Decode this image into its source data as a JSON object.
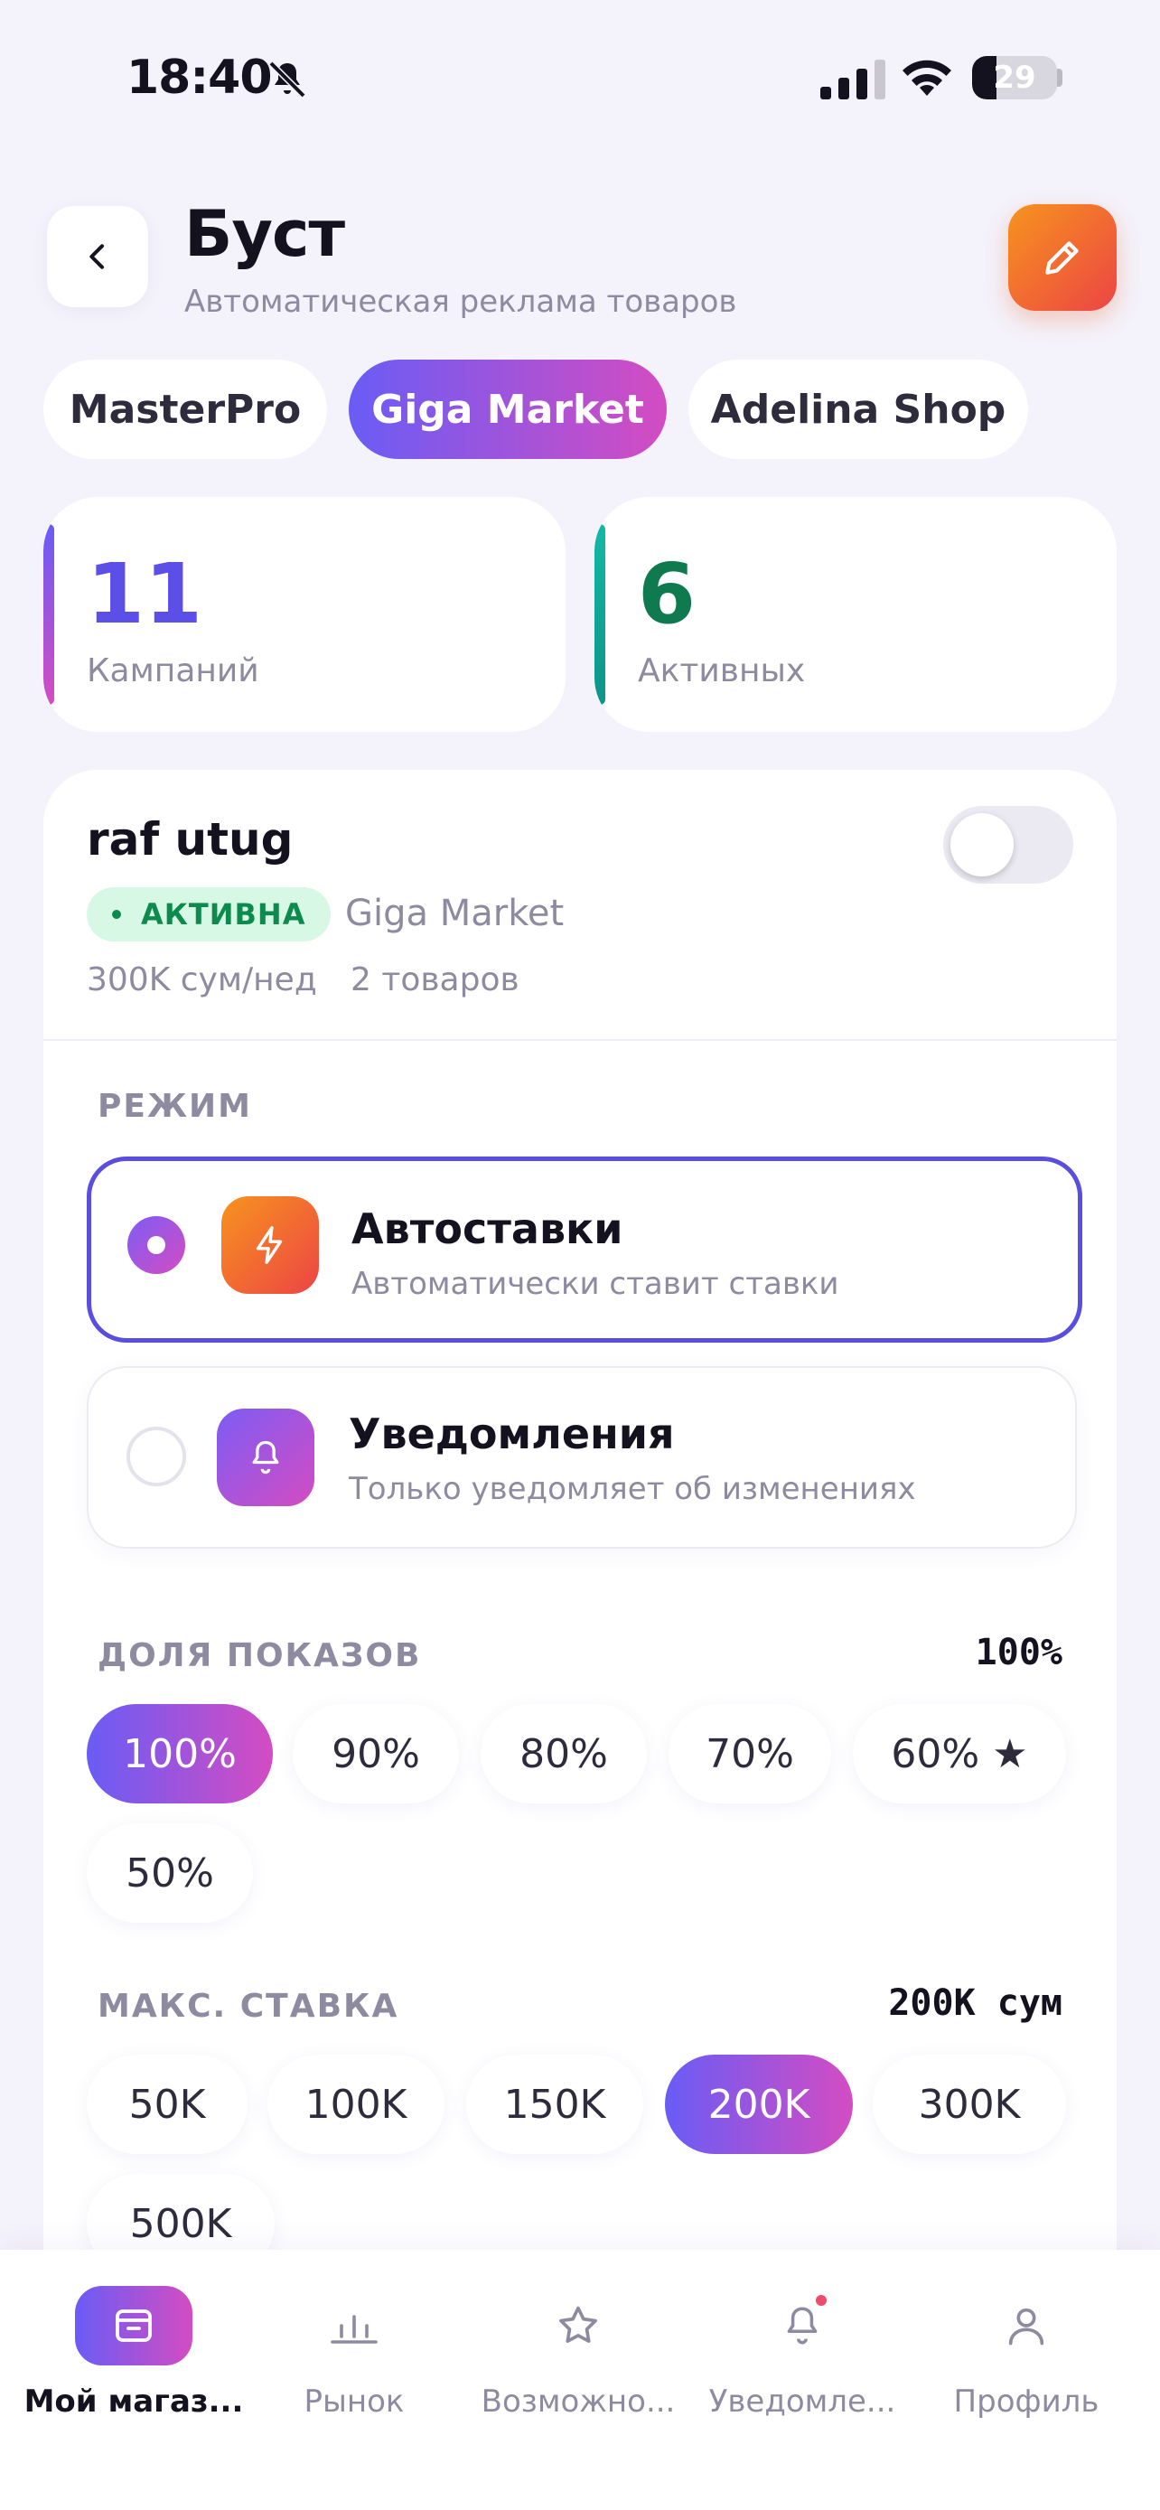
{
  "status_bar": {
    "time": "18:40",
    "battery": "29"
  },
  "header": {
    "title": "Буст",
    "subtitle": "Автоматическая реклама товаров",
    "back_icon": "chevron-left-icon",
    "edit_icon": "pencil-icon",
    "edit_color": "#f26b2f"
  },
  "shops": [
    {
      "label": "MasterPro",
      "active": false
    },
    {
      "label": "Giga Market",
      "active": true
    },
    {
      "label": "Adelina Shop",
      "active": false
    }
  ],
  "stats": [
    {
      "value": "11",
      "label": "Кампаний",
      "color": "#5b4fe8"
    },
    {
      "value": "6",
      "label": "Активных",
      "color": "#0f7a50"
    }
  ],
  "campaign": {
    "name": "raf utug",
    "enabled": false,
    "status": "АКТИВНА",
    "shop": "Giga Market",
    "budget": "300K сум/нед",
    "products": "2 товаров"
  },
  "mode": {
    "label": "РЕЖИМ",
    "options": [
      {
        "title": "Автоставки",
        "desc": "Автоматически ставит ставки",
        "icon": "lightning-icon",
        "selected": true
      },
      {
        "title": "Уведомления",
        "desc": "Только уведомляет об изменениях",
        "icon": "bell-icon",
        "selected": false
      }
    ]
  },
  "share": {
    "label": "ДОЛЯ ПОКАЗОВ",
    "value": "100%",
    "options": [
      "100%",
      "90%",
      "80%",
      "70%",
      "60% ★",
      "50%"
    ],
    "selected_index": 0
  },
  "max_bid": {
    "label": "МАКС. СТАВКА",
    "value": "200K сум",
    "options": [
      "50K",
      "100K",
      "150K",
      "200K",
      "300K",
      "500K"
    ],
    "selected_index": 3
  },
  "nav": [
    {
      "label": "Мой магаз...",
      "icon": "store-icon",
      "active": true
    },
    {
      "label": "Рынок",
      "icon": "bar-chart-icon",
      "active": false
    },
    {
      "label": "Возможно...",
      "icon": "star-icon",
      "active": false
    },
    {
      "label": "Уведомле...",
      "icon": "bell-icon",
      "active": false,
      "dot": true
    },
    {
      "label": "Профиль",
      "icon": "user-icon",
      "active": false
    }
  ],
  "colors": {
    "accent_start": "#6a5cf5",
    "accent_end": "#d44cc2",
    "status_green": "#0d8a4e"
  }
}
